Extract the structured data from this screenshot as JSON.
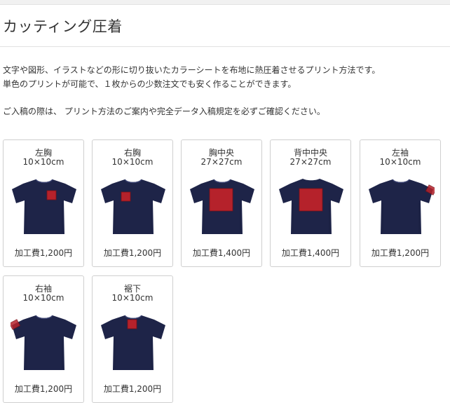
{
  "page": {
    "title": "カッティング圧着",
    "description": [
      "文字や図形、イラストなどの形に切り抜いたカラーシートを布地に熱圧着させるプリント方法です。",
      "単色のプリントが可能で、１枚からの少数注文でも安く作ることができます。",
      "ご入稿の際は、 プリント方法のご案内や完全データ入稿規定を必ずご確認ください。"
    ]
  },
  "colors": {
    "shirt": "#1e2448",
    "print_area": "#b5222b",
    "print_border": "#7a0f16"
  },
  "positions": [
    {
      "name": "左胸",
      "size": "10×10cm",
      "price": "加工費1,200円",
      "view": "front",
      "area": "left-chest"
    },
    {
      "name": "右胸",
      "size": "10×10cm",
      "price": "加工費1,200円",
      "view": "front",
      "area": "right-chest"
    },
    {
      "name": "胸中央",
      "size": "27×27cm",
      "price": "加工費1,400円",
      "view": "front",
      "area": "chest-center"
    },
    {
      "name": "背中中央",
      "size": "27×27cm",
      "price": "加工費1,400円",
      "view": "back",
      "area": "back-center"
    },
    {
      "name": "左袖",
      "size": "10×10cm",
      "price": "加工費1,200円",
      "view": "front",
      "area": "left-sleeve"
    },
    {
      "name": "右袖",
      "size": "10×10cm",
      "price": "加工費1,200円",
      "view": "front",
      "area": "right-sleeve"
    },
    {
      "name": "裾下",
      "size": "10×10cm",
      "price": "加工費1,200円",
      "view": "front",
      "area": "hem"
    }
  ]
}
